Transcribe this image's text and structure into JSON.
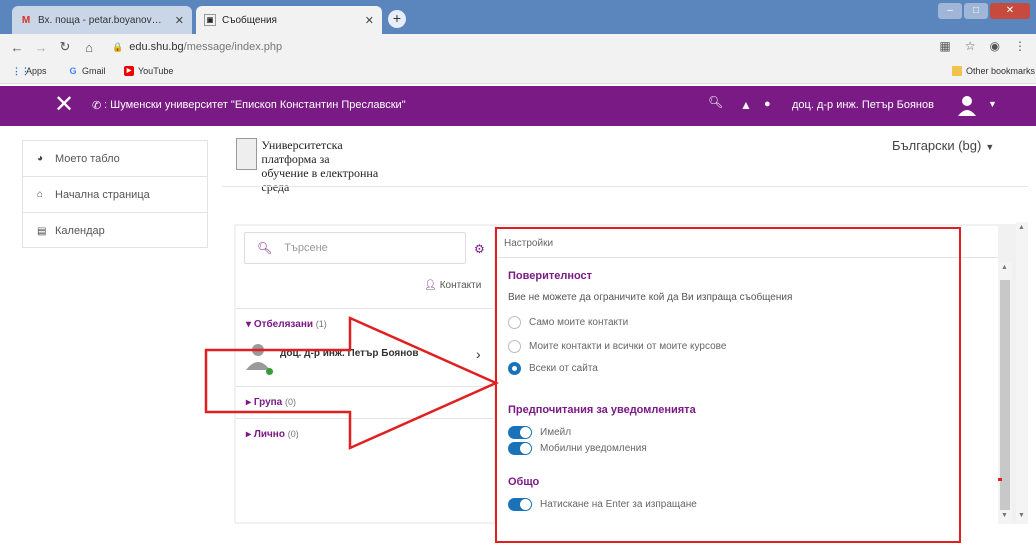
{
  "browser": {
    "tabs": [
      {
        "title": "Вх. поща - petar.boyanov@shu.b",
        "favicon": "gmail-icon",
        "active": false
      },
      {
        "title": "Съобщения",
        "favicon": "moodle-icon",
        "active": true
      }
    ],
    "new_tab": "+",
    "url_host": "edu.shu.bg",
    "url_path": "/message/index.php",
    "bookmarks": [
      {
        "label": "Apps",
        "icon": "apps-grid-icon"
      },
      {
        "label": "Gmail",
        "icon": "google-icon"
      },
      {
        "label": "YouTube",
        "icon": "youtube-icon"
      }
    ],
    "other_bookmarks": "Other bookmarks"
  },
  "navbar": {
    "site_title": ": Шуменски университет \"Епископ Константин Преславски\"",
    "user_name": "доц. д-р инж. Петър Боянов",
    "bg_color": "#7a1a85"
  },
  "left_nav": {
    "items": [
      {
        "label": "Моето табло",
        "icon": "dashboard-icon"
      },
      {
        "label": "Начална страница",
        "icon": "home-icon"
      },
      {
        "label": "Календар",
        "icon": "calendar-icon"
      }
    ]
  },
  "header": {
    "logo_line1": "Университетска платформа за",
    "logo_line2": "обучение в електронна среда",
    "language": "Български (bg)"
  },
  "messages": {
    "search_placeholder": "Търсене",
    "contacts_link": "Контакти",
    "sections": [
      {
        "label": "Отбелязани",
        "count": "(1)",
        "expanded": true
      },
      {
        "label": "Група",
        "count": "(0)",
        "expanded": false
      },
      {
        "label": "Лично",
        "count": "(0)",
        "expanded": false
      }
    ],
    "conversation": {
      "name": "доц. д-р инж. Петър Боянов",
      "online": true
    }
  },
  "settings": {
    "title": "Настройки",
    "privacy": {
      "heading": "Поверителност",
      "description": "Вие не можете да ограничите кой да Ви изпраща съобщения",
      "options": [
        {
          "label": "Само моите контакти",
          "checked": false
        },
        {
          "label": "Моите контакти и всички от моите курсове",
          "checked": false
        },
        {
          "label": "Всеки от сайта",
          "checked": true
        }
      ]
    },
    "notifications": {
      "heading": "Предпочитания за уведомленията",
      "toggles": [
        {
          "label": "Имейл",
          "on": true
        },
        {
          "label": "Мобилни уведомления",
          "on": true
        }
      ]
    },
    "general": {
      "heading": "Общо",
      "toggles": [
        {
          "label": "Натискане на Enter за изпращане",
          "on": true
        }
      ]
    }
  },
  "annotation_color": "#e02020"
}
